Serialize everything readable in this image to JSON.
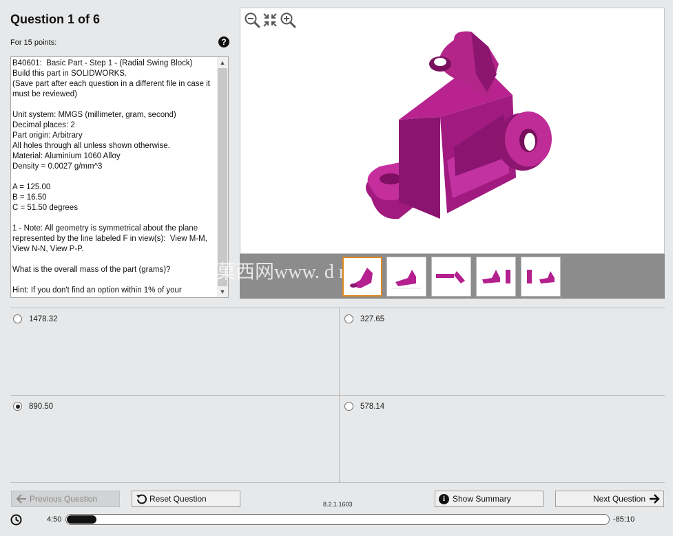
{
  "header": {
    "title": "Question 1 of 6",
    "points": "For 15 points:",
    "help_icon": "question-circle-icon"
  },
  "question": {
    "text": "B40601:  Basic Part - Step 1 - (Radial Swing Block)\nBuild this part in SOLIDWORKS.\n(Save part after each question in a different file in case it must be reviewed)\n\nUnit system: MMGS (millimeter, gram, second)\nDecimal places: 2\nPart origin: Arbitrary\nAll holes through all unless shown otherwise.\nMaterial: Aluminium 1060 Alloy\nDensity = 0.0027 g/mm^3\n\nA = 125.00\nB = 16.50\nC = 51.50 degrees\n\n1 - Note: All geometry is symmetrical about the plane represented by the line labeled F in view(s):  View M-M, View N-N, View P-P.\n\nWhat is the overall mass of the part (grams)?\n\nHint: If you don't find an option within 1% of your"
  },
  "viewer": {
    "zoom_out_icon": "zoom-out-icon",
    "fit_icon": "fit-to-window-icon",
    "zoom_in_icon": "zoom-in-icon",
    "watermark": "菓西网www. d n c   c",
    "thumbnails_selected_index": 0
  },
  "options": [
    {
      "label": "1478.32",
      "checked": false
    },
    {
      "label": "327.65",
      "checked": false
    },
    {
      "label": "890.50",
      "checked": true
    },
    {
      "label": "578.14",
      "checked": false
    }
  ],
  "footer": {
    "previous": "Previous Question",
    "reset": "Reset Question",
    "version": "8.2.1.1603",
    "summary": "Show Summary",
    "next": "Next Question",
    "time_elapsed": "4:50",
    "time_remaining": "-85:10",
    "progress_fraction": 0.055
  },
  "colors": {
    "part": "#b4208e",
    "selected_thumb_border": "#e08a1f"
  }
}
